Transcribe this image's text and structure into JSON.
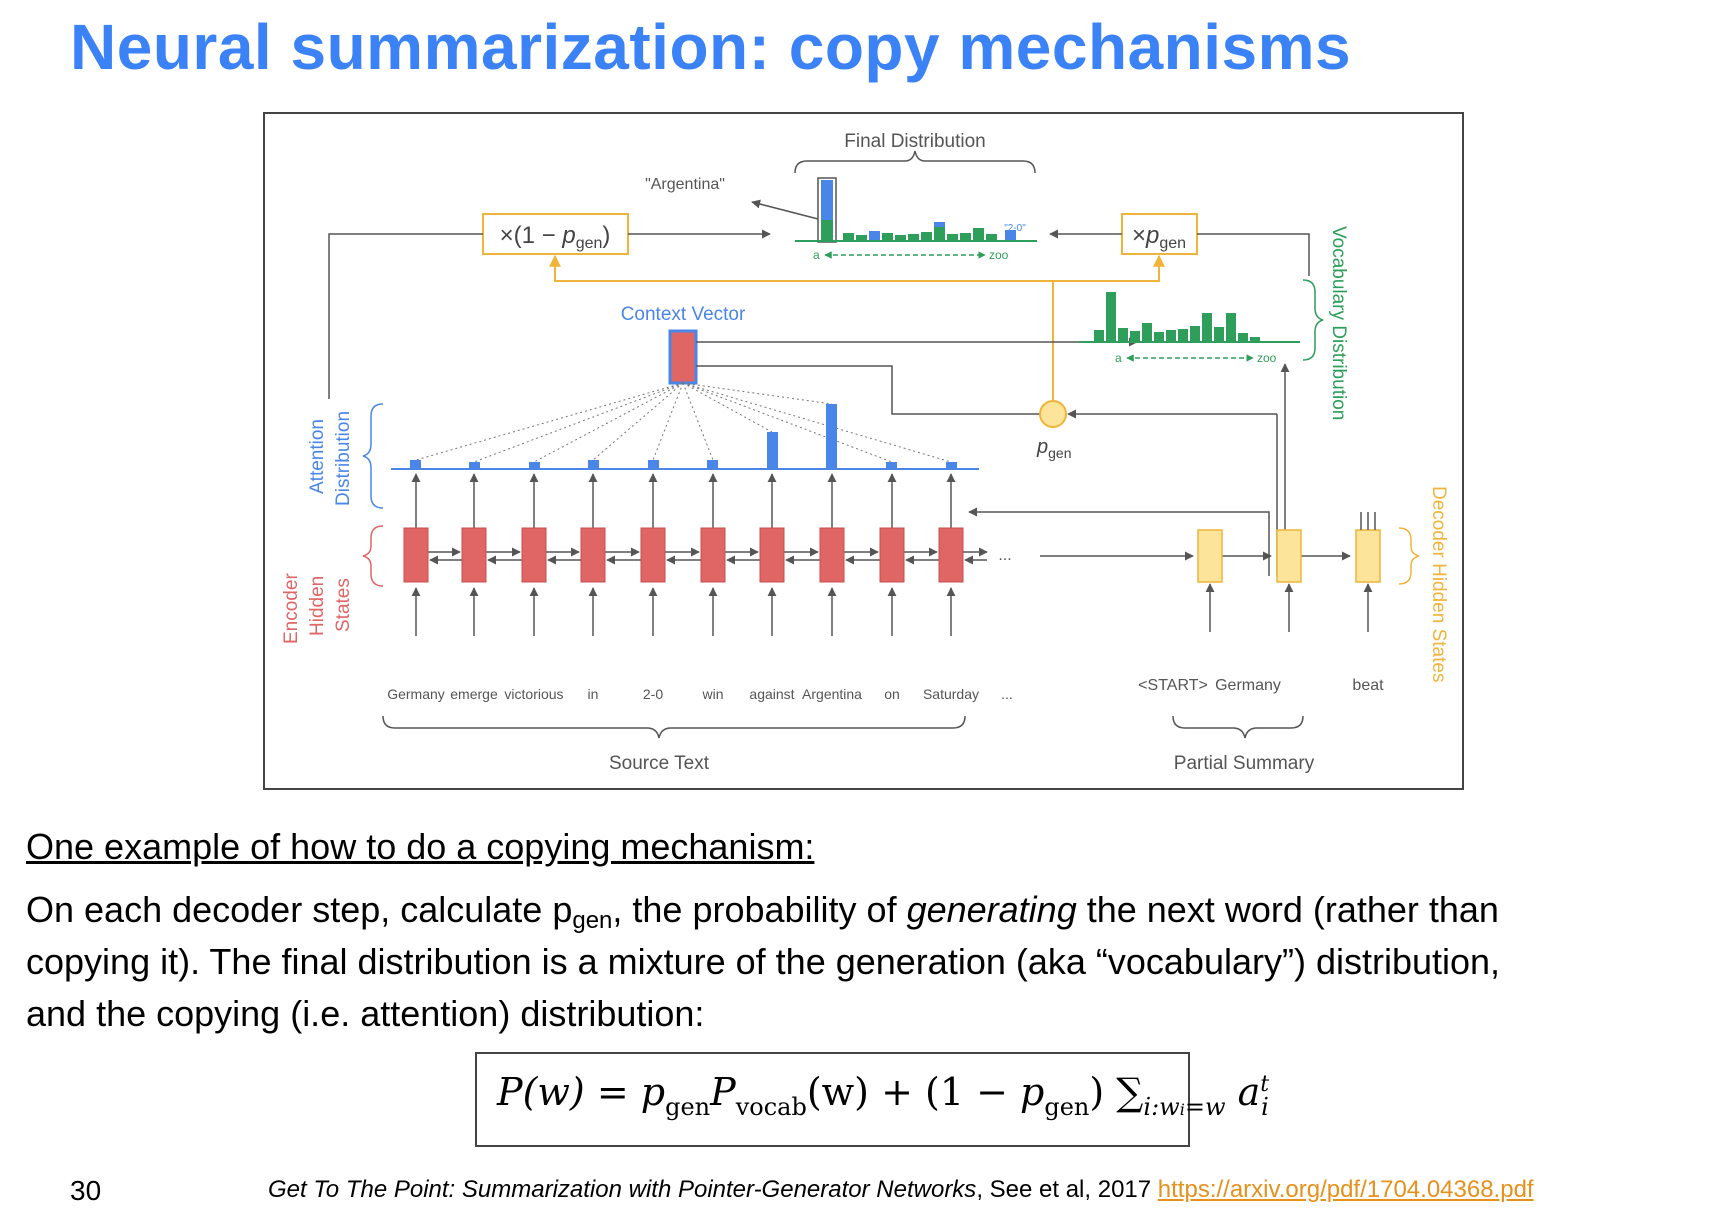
{
  "slide": {
    "title": "Neural summarization: copy mechanisms",
    "page_number": "30"
  },
  "diagram": {
    "final_distribution_label": "Final Distribution",
    "argentina_label": "\"Argentina\"",
    "mix_left_prefix": "×(1 − ",
    "mix_left_p": "p",
    "mix_left_sub": "gen",
    "mix_left_suffix": ")",
    "mix_right_prefix": "×",
    "mix_right_p": "p",
    "mix_right_sub": "gen",
    "two_zero_label": "\"2-0\"",
    "axis_a": "a",
    "axis_zoo": "zoo",
    "context_vector_label": "Context Vector",
    "vocab_dist_label": "Vocabulary Distribution",
    "pgen_p": "p",
    "pgen_sub": "gen",
    "attention_label_1": "Attention",
    "attention_label_2": "Distribution",
    "encoder_label_1": "Encoder",
    "encoder_label_2": "Hidden",
    "encoder_label_3": "States",
    "decoder_label": "Decoder Hidden States",
    "ellipsis": "...",
    "source_words": [
      "Germany",
      "emerge",
      "victorious",
      "in",
      "2-0",
      "win",
      "against",
      "Argentina",
      "on",
      "Saturday",
      "..."
    ],
    "summary_words": [
      "<START>",
      "Germany",
      "beat"
    ],
    "source_text_label": "Source Text",
    "partial_summary_label": "Partial Summary",
    "colors": {
      "blue": "#4a86e8",
      "red": "#e06666",
      "green": "#2e9e5b",
      "orange": "#f1b43a",
      "yellow_fill": "#fde49b"
    }
  },
  "body": {
    "subhead": "One example of how to do a copying mechanism:",
    "line1_a": "On each decoder step, calculate p",
    "line1_sub": "gen",
    "line1_b": ", the probability of ",
    "line1_em": "generating",
    "line1_c": " the next word (rather than",
    "line2": "copying it). The final distribution is a mixture of the generation (aka “vocabulary”) distribution,",
    "line3": "and the copying (i.e. attention) distribution:"
  },
  "formula": {
    "lhs": "P(w) = ",
    "p1": "p",
    "p1_sub": "gen",
    "P2": "P",
    "P2_sub": "vocab",
    "mid": "(w) + (1 − ",
    "p3": "p",
    "p3_sub": "gen",
    "close": ") ",
    "sigma": "∑",
    "sigma_sub": "i:w",
    "sigma_sub_i": "i",
    "sigma_sub_eq": "=w",
    "a": "a",
    "a_sup": "t",
    "a_sub": "i"
  },
  "citation": {
    "title": "Get To The Point: Summarization with Pointer-Generator Networks",
    "authors": ", See et al, 2017 ",
    "url": "https://arxiv.org/pdf/1704.04368.pdf"
  }
}
